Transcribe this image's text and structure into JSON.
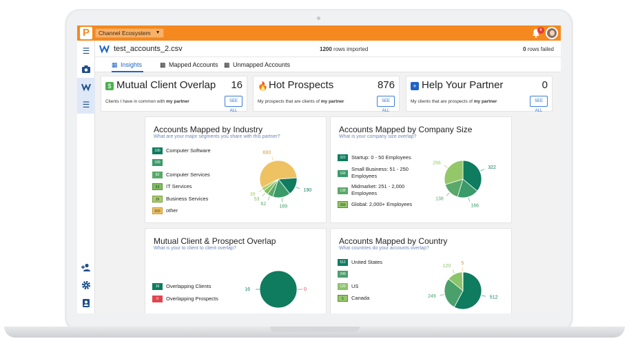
{
  "app": {
    "ecosystem_select": "Channel Ecosystem",
    "notification_count": "6",
    "logo_letter": "P"
  },
  "file": {
    "name": "test_accounts_2.csv",
    "rows_imported_count": "1200",
    "rows_imported_text": "rows imported",
    "rows_failed_count": "0",
    "rows_failed_text": "rows failed"
  },
  "tabs": [
    {
      "label": "Insights",
      "icon": "chart-icon",
      "active": true
    },
    {
      "label": "Mapped Accounts",
      "icon": "clipboard-check-icon",
      "active": false
    },
    {
      "label": "Unmapped Accounts",
      "icon": "clipboard-x-icon",
      "active": false
    }
  ],
  "stats": [
    {
      "title": "Mutual Client Overlap",
      "value": "16",
      "desc_prefix": "Clients I have in common with ",
      "desc_bold": "my partner",
      "button": "SEE ALL",
      "icon": "dollar-icon",
      "color": "#4caf50"
    },
    {
      "title": "Hot Prospects",
      "value": "876",
      "desc_prefix": "My prospects that are clients of ",
      "desc_bold": "my partner",
      "button": "SEE ALL",
      "icon": "flame-icon",
      "color": "#f5891f"
    },
    {
      "title": "Help Your Partner",
      "value": "0",
      "desc_prefix": "My clients that are prospects of ",
      "desc_bold": "my partner",
      "button": "SEE ALL",
      "icon": "plus-square-icon",
      "color": "#1e63c7"
    }
  ],
  "panels": {
    "industry": {
      "title": "Accounts Mapped by Industry",
      "subtitle": "What are your major segments you share with this partner?",
      "legend": [
        {
          "value": "190",
          "label": "Computer Software"
        },
        {
          "value": "189",
          "label": ""
        },
        {
          "value": "62",
          "label": "Computer Services"
        },
        {
          "value": "53",
          "label": "IT Services"
        },
        {
          "value": "39",
          "label": "Business Services"
        },
        {
          "value": "693",
          "label": "other"
        }
      ]
    },
    "size": {
      "title": "Accounts Mapped by Company Size",
      "subtitle": "What is your company size overlap?",
      "legend": [
        {
          "value": "322",
          "label": "Startup: 0 - 50 Employees"
        },
        {
          "value": "166",
          "label": "Small Business: 51 - 250 Employees"
        },
        {
          "value": "138",
          "label": "Midmarket: 251 - 2,000 Employees"
        },
        {
          "value": "266",
          "label": "Global: 2,000+ Employees"
        }
      ]
    },
    "overlap": {
      "title": "Mutual Client & Prospect Overlap",
      "subtitle": "What is your to client to client overlap?",
      "legend": [
        {
          "value": "16",
          "label": "Overlapping Clients"
        },
        {
          "value": "0",
          "label": "Overlapping Prospects"
        }
      ]
    },
    "country": {
      "title": "Accounts Mapped by Country",
      "subtitle": "What countries do your accounts overlap?",
      "legend": [
        {
          "value": "512",
          "label": "United States"
        },
        {
          "value": "249",
          "label": ""
        },
        {
          "value": "120",
          "label": "US"
        },
        {
          "value": "5",
          "label": "Canada"
        }
      ]
    }
  },
  "chart_data": [
    {
      "type": "pie",
      "title": "Accounts Mapped by Industry",
      "categories": [
        "Computer Software",
        "",
        "Computer Services",
        "IT Services",
        "Business Services",
        "other"
      ],
      "values": [
        190,
        189,
        62,
        53,
        39,
        693
      ],
      "colors": [
        "#0f7b5f",
        "#3a9a6a",
        "#5aa86a",
        "#7fbf5f",
        "#a8cf6b",
        "#eec262"
      ],
      "data_labels": [
        "190",
        "189",
        "62",
        "53",
        "39",
        "693"
      ]
    },
    {
      "type": "pie",
      "title": "Accounts Mapped by Company Size",
      "categories": [
        "Startup: 0 - 50 Employees",
        "Small Business: 51 - 250 Employees",
        "Midmarket: 251 - 2,000 Employees",
        "Global: 2,000+ Employees"
      ],
      "values": [
        322,
        166,
        138,
        266
      ],
      "colors": [
        "#0f7b5f",
        "#3a9a6a",
        "#5aa86a",
        "#94c76a"
      ],
      "data_labels": [
        "322",
        "166",
        "138",
        "266"
      ]
    },
    {
      "type": "pie",
      "title": "Mutual Client & Prospect Overlap",
      "categories": [
        "Overlapping Clients",
        "Overlapping Prospects"
      ],
      "values": [
        16,
        0
      ],
      "colors": [
        "#0f7b5f",
        "#e04550"
      ],
      "data_labels": [
        "16",
        "0"
      ]
    },
    {
      "type": "pie",
      "title": "Accounts Mapped by Country",
      "categories": [
        "United States",
        "",
        "US",
        "Canada"
      ],
      "values": [
        512,
        249,
        120,
        5
      ],
      "colors": [
        "#0f7b5f",
        "#4aa06a",
        "#8cc46a",
        "#eec262"
      ],
      "data_labels": [
        "512",
        "249",
        "120",
        "5"
      ]
    }
  ]
}
